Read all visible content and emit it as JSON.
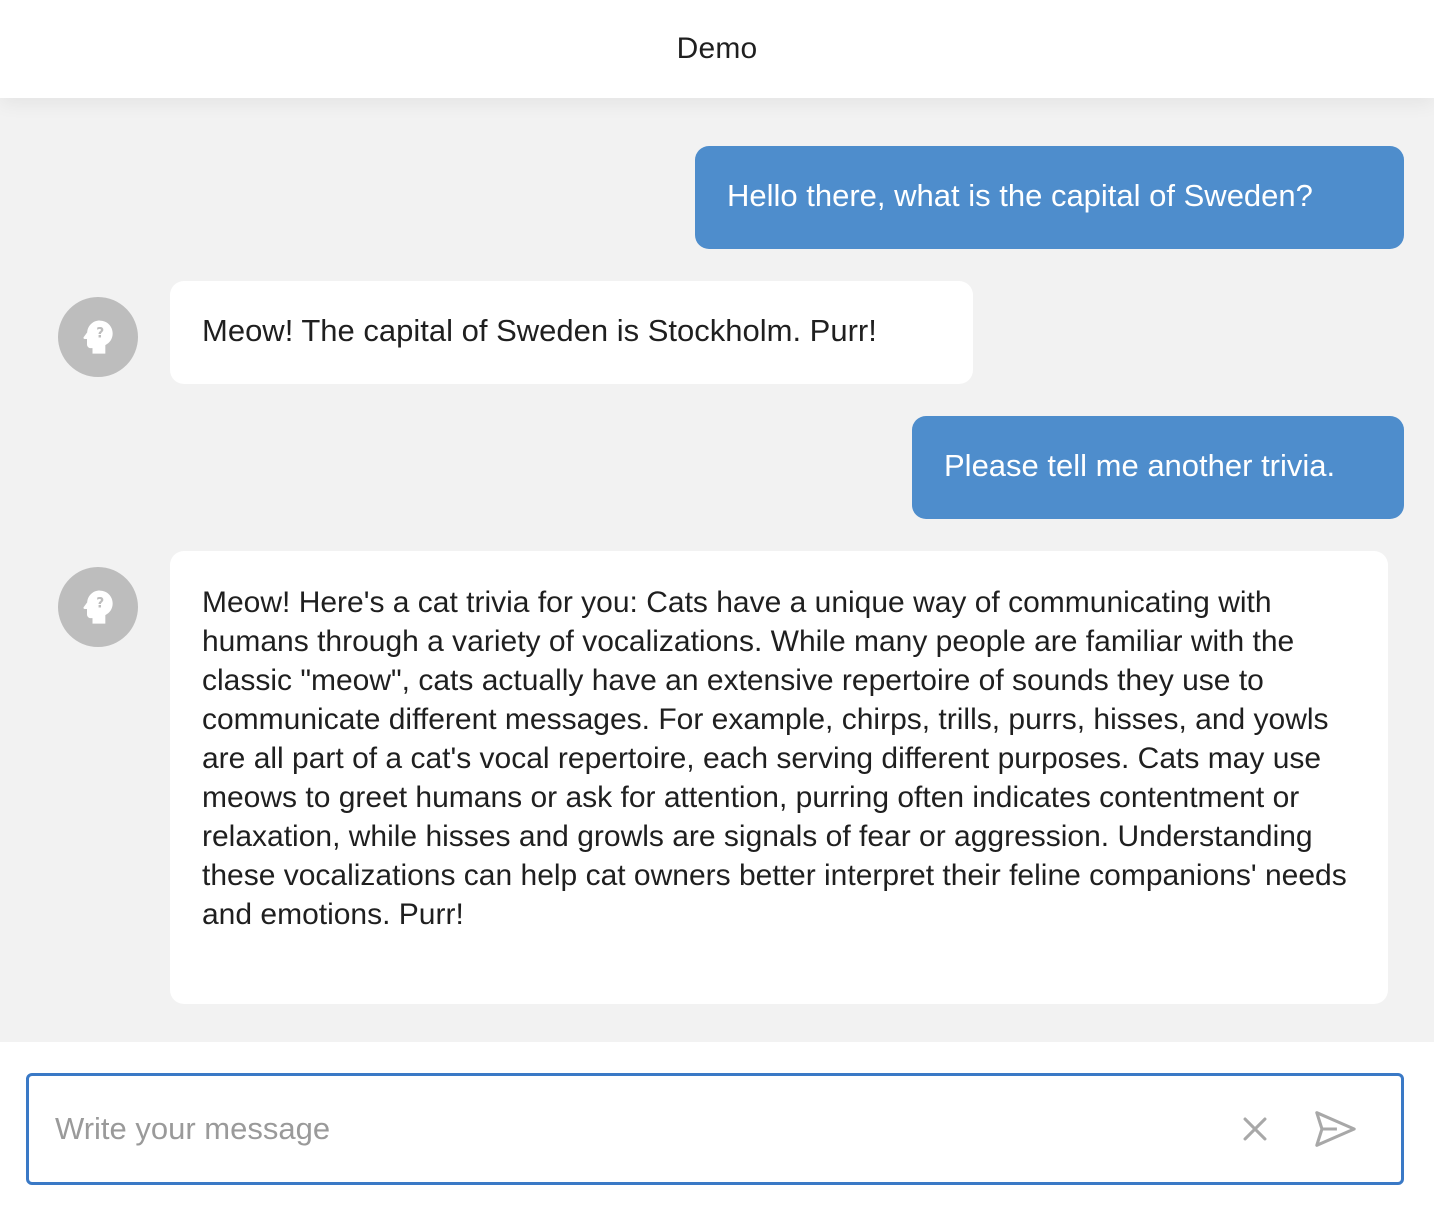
{
  "header": {
    "title": "Demo"
  },
  "messages": [
    {
      "role": "user",
      "text": "Hello there, what is the capital of Sweden?"
    },
    {
      "role": "bot",
      "avatar_icon": "help-head-icon",
      "text": "Meow! The capital of Sweden is Stockholm. Purr!"
    },
    {
      "role": "user",
      "text": "Please tell me another trivia."
    },
    {
      "role": "bot",
      "avatar_icon": "help-head-icon",
      "text": "Meow! Here's a cat trivia for you: Cats have a unique way of communicating with humans through a variety of vocalizations. While many people are familiar with the classic \"meow\", cats actually have an extensive repertoire of sounds they use to communicate different messages. For example, chirps, trills, purrs, hisses, and yowls are all part of a cat's vocal repertoire, each serving different purposes. Cats may use meows to greet humans or ask for attention, purring often indicates contentment or relaxation, while hisses and growls are signals of fear or aggression. Understanding these vocalizations can help cat owners better interpret their feline companions' needs and emotions. Purr!"
    }
  ],
  "composer": {
    "placeholder": "Write your message",
    "value": "",
    "clear_icon": "close-icon",
    "send_icon": "send-icon"
  },
  "colors": {
    "accent": "#4e8dcc",
    "input_border": "#3a79c6",
    "chat_background": "#f2f2f2",
    "avatar": "#bdbdbd"
  }
}
